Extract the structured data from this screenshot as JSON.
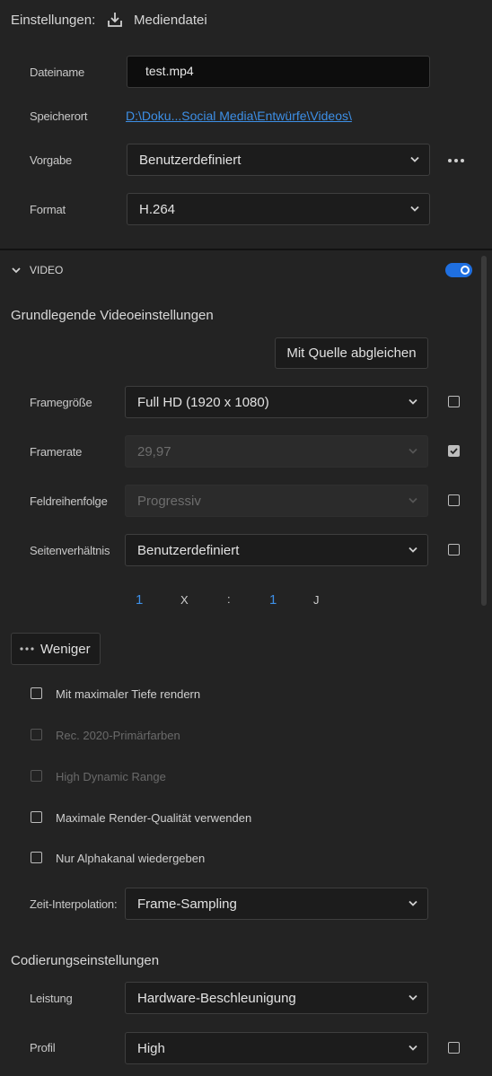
{
  "header": {
    "settings_label": "Einstellungen:",
    "export_target": "Mediendatei",
    "icon": "download-icon"
  },
  "file": {
    "filename_label": "Dateiname",
    "filename_value": "test.mp4",
    "location_label": "Speicherort",
    "location_value": "D:\\Doku...Social Media\\Entwürfe\\Videos\\",
    "preset_label": "Vorgabe",
    "preset_value": "Benutzerdefiniert",
    "format_label": "Format",
    "format_value": "H.264",
    "more_icon": "more-horizontal-icon"
  },
  "video_section": {
    "title": "VIDEO",
    "enabled": true,
    "basic_title": "Grundlegende Videoeinstellungen",
    "match_source_label": "Mit Quelle abgleichen",
    "frame_size_label": "Framegröße",
    "frame_size_value": "Full HD (1920 x 1080)",
    "frame_size_checked": false,
    "frame_rate_label": "Framerate",
    "frame_rate_value": "29,97",
    "frame_rate_checked": true,
    "field_order_label": "Feldreihenfolge",
    "field_order_value": "Progressiv",
    "field_order_checked": false,
    "aspect_label": "Seitenverhältnis",
    "aspect_value": "Benutzerdefiniert",
    "aspect_checked": false,
    "aspect_w": "1",
    "aspect_x": "X",
    "aspect_colon": ":",
    "aspect_h": "1",
    "aspect_unit": "J",
    "less_label": "Weniger",
    "options": [
      {
        "label": "Mit maximaler Tiefe rendern",
        "enabled": true,
        "checked": false
      },
      {
        "label": "Rec. 2020-Primärfarben",
        "enabled": false,
        "checked": false
      },
      {
        "label": "High Dynamic Range",
        "enabled": false,
        "checked": false
      },
      {
        "label": "Maximale Render-Qualität verwenden",
        "enabled": true,
        "checked": false
      },
      {
        "label": "Nur Alphakanal wiedergeben",
        "enabled": true,
        "checked": false
      }
    ],
    "time_interp_label": "Zeit-Interpolation:",
    "time_interp_value": "Frame-Sampling"
  },
  "encoding": {
    "title": "Codierungseinstellungen",
    "performance_label": "Leistung",
    "performance_value": "Hardware-Beschleunigung",
    "profile_label": "Profil",
    "profile_value": "High",
    "profile_checked": false
  },
  "colors": {
    "background": "#232323",
    "accent": "#3d8fe6",
    "toggle_on": "#1f6fe0"
  }
}
